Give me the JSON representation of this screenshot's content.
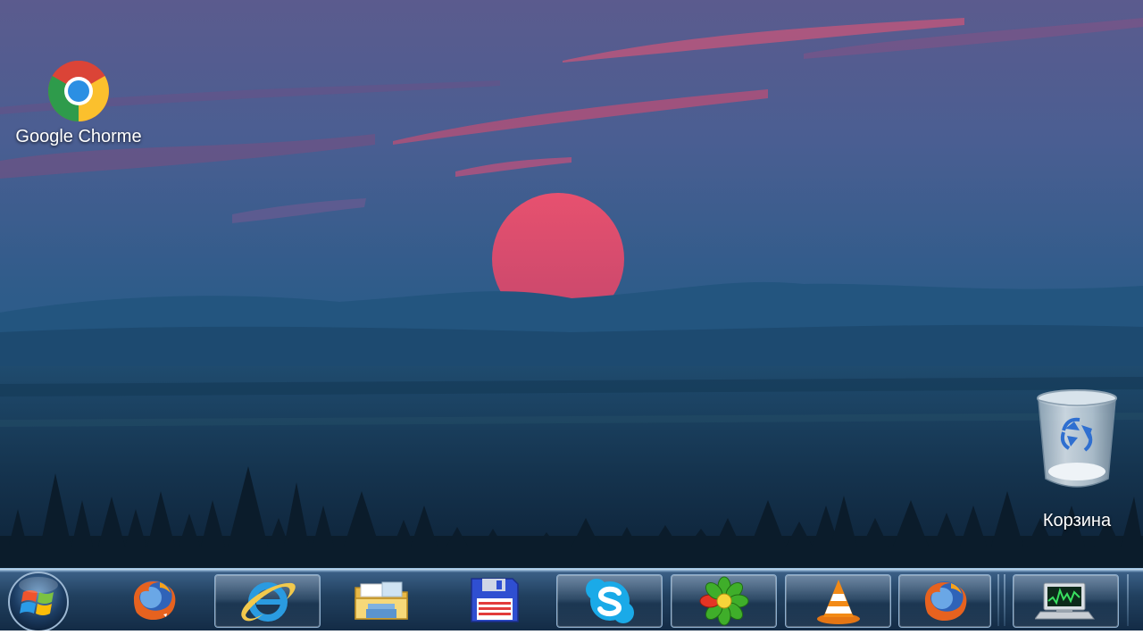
{
  "desktop": {
    "icons": [
      {
        "label": "Google Chorme",
        "icon": "chrome-icon"
      },
      {
        "label": "Корзина",
        "icon": "recycle-bin-icon"
      }
    ]
  },
  "taskbar": {
    "start_icon": "windows-logo-icon",
    "buttons": [
      {
        "icon": "firefox-icon",
        "framed": false
      },
      {
        "icon": "internet-explorer-icon",
        "framed": true
      },
      {
        "icon": "file-explorer-folder-icon",
        "framed": false
      },
      {
        "icon": "floppy-disk-icon",
        "framed": false
      },
      {
        "icon": "skype-icon",
        "framed": true
      },
      {
        "icon": "icq-flower-icon",
        "framed": true
      },
      {
        "icon": "vlc-cone-icon",
        "framed": true
      },
      {
        "icon": "firefox-icon",
        "framed": true
      },
      {
        "icon": "system-monitor-icon",
        "framed": true
      }
    ]
  },
  "colors": {
    "sky_top": "#5a5a8f",
    "sky_mid": "#2f5d88",
    "sun": "#e0506e",
    "taskbar": "#21405f"
  }
}
